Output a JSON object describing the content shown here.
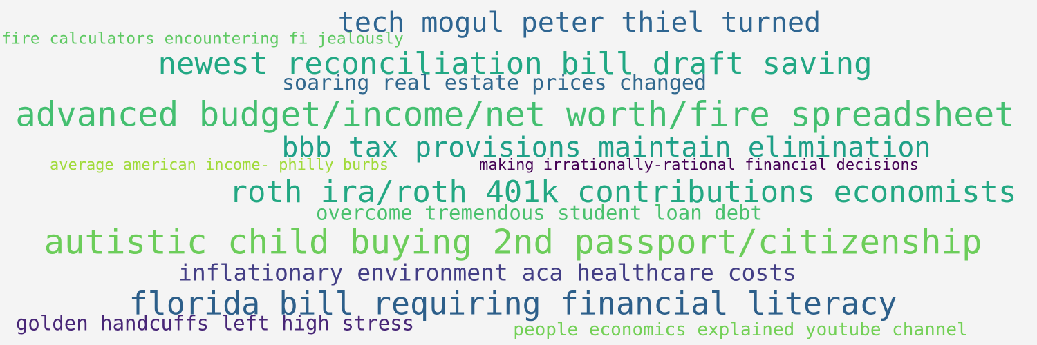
{
  "phrases": [
    {
      "text": "tech mogul peter thiel turned",
      "color": "#2e6591"
    },
    {
      "text": "fire calculators encountering fi jealously",
      "color": "#5ec962"
    },
    {
      "text": "newest reconciliation bill draft saving",
      "color": "#22a884"
    },
    {
      "text": "soaring real estate prices changed",
      "color": "#31688e"
    },
    {
      "text": "advanced budget/income/net worth/fire spreadsheet",
      "color": "#44bf70"
    },
    {
      "text": "bbb tax provisions maintain elimination",
      "color": "#1fa088"
    },
    {
      "text": "average american income- philly burbs",
      "color": "#a0da39"
    },
    {
      "text": "making irrationally-rational financial decisions",
      "color": "#440154"
    },
    {
      "text": "roth ira/roth 401k contributions economists",
      "color": "#23a883"
    },
    {
      "text": "overcome tremendous student loan debt",
      "color": "#4ac16d"
    },
    {
      "text": "autistic child buying 2nd passport/citizenship",
      "color": "#6ccd5a"
    },
    {
      "text": "inflationary environment aca healthcare costs",
      "color": "#433e85"
    },
    {
      "text": "florida bill requiring financial literacy",
      "color": "#2d5f8a"
    },
    {
      "text": "golden handcuffs left high stress",
      "color": "#482677"
    },
    {
      "text": "people economics explained youtube channel",
      "color": "#73d056"
    }
  ]
}
